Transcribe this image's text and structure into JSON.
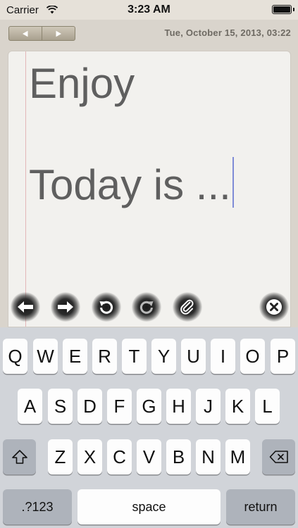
{
  "status_bar": {
    "carrier": "Carrier",
    "time": "3:23 AM"
  },
  "nav": {
    "date": "Tue, October 15, 2013, 03:22"
  },
  "note": {
    "lines": [
      "Enjoy",
      "",
      "Today is ..."
    ]
  },
  "keyboard": {
    "row1": [
      "Q",
      "W",
      "E",
      "R",
      "T",
      "Y",
      "U",
      "I",
      "O",
      "P"
    ],
    "row2": [
      "A",
      "S",
      "D",
      "F",
      "G",
      "H",
      "J",
      "K",
      "L"
    ],
    "row3": [
      "Z",
      "X",
      "C",
      "V",
      "B",
      "N",
      "M"
    ],
    "numbers_label": ".?123",
    "space_label": "space",
    "return_label": "return"
  }
}
